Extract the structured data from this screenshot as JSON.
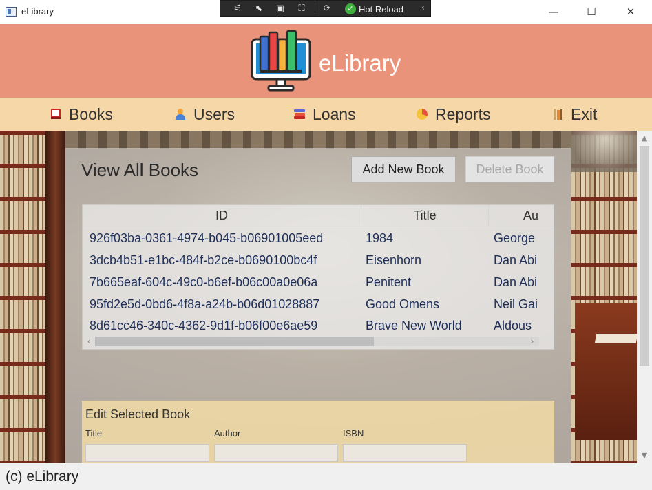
{
  "window": {
    "title": "eLibrary",
    "minimize_glyph": "—",
    "maximize_glyph": "☐",
    "close_glyph": "✕"
  },
  "debug_toolbar": {
    "hot_reload_label": "Hot Reload",
    "icons": [
      "live-visual-tree-icon",
      "select-element-icon",
      "display-adorners-icon",
      "track-focus-icon",
      "binding-failures-icon"
    ]
  },
  "header": {
    "app_title": "eLibrary"
  },
  "nav": {
    "items": [
      {
        "label": "Books",
        "icon": "book-icon",
        "color": "#c62828"
      },
      {
        "label": "Users",
        "icon": "user-icon",
        "color": "#f4a53a"
      },
      {
        "label": "Loans",
        "icon": "books-stack-icon",
        "color": "#5d6bd9"
      },
      {
        "label": "Reports",
        "icon": "pie-chart-icon",
        "color": "#e5533d"
      },
      {
        "label": "Exit",
        "icon": "exit-book-icon",
        "color": "#e08a3a"
      }
    ]
  },
  "main": {
    "title": "View All Books",
    "add_button": "Add New Book",
    "delete_button": "Delete Book",
    "table": {
      "columns": [
        "ID",
        "Title",
        "Au"
      ],
      "rows": [
        [
          "926f03ba-0361-4974-b045-b06901005eed",
          "1984",
          "George"
        ],
        [
          "3dcb4b51-e1bc-484f-b2ce-b0690100bc4f",
          "Eisenhorn",
          "Dan Abi"
        ],
        [
          "7b665eaf-604c-49c0-b6ef-b06c00a0e06a",
          "Penitent",
          "Dan Abi"
        ],
        [
          "95fd2e5d-0bd6-4f8a-a24b-b06d01028887",
          "Good Omens",
          "Neil Gai"
        ],
        [
          "8d61cc46-340c-4362-9d1f-b06f00e6ae59",
          "Brave New World",
          "Aldous"
        ]
      ]
    },
    "edit": {
      "title": "Edit Selected Book",
      "title_label": "Title",
      "author_label": "Author",
      "isbn_label": "ISBN",
      "title_value": "",
      "author_value": "",
      "isbn_value": ""
    }
  },
  "footer": {
    "text": "(c) eLibrary"
  },
  "colors": {
    "banner": "#e9937a",
    "navbar": "#f6d7a8",
    "edit_section": "#f7dfa6",
    "cell_text": "#1e2f5a"
  }
}
